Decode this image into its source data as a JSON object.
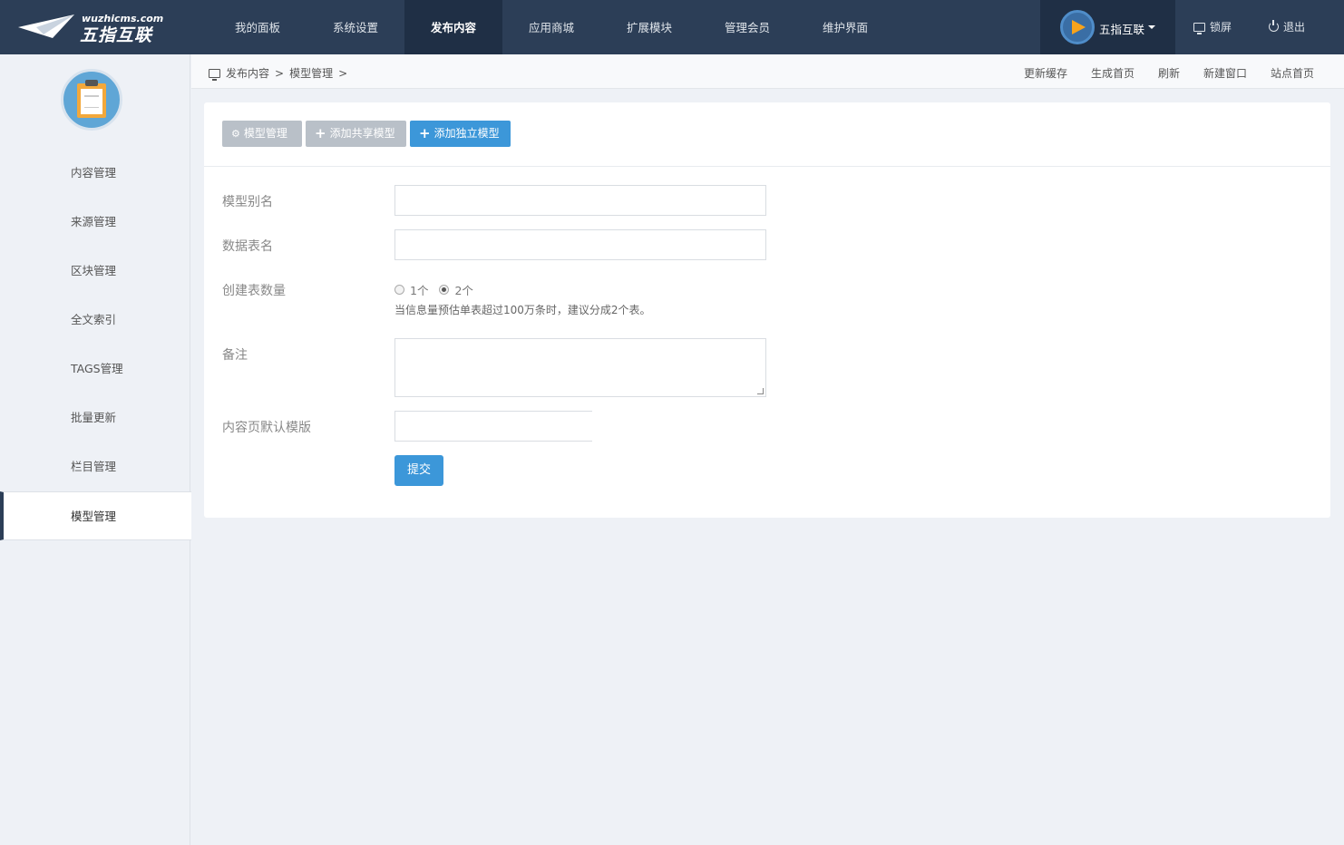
{
  "brand": {
    "url": "wuzhicms.com",
    "name": "五指互联"
  },
  "nav": {
    "items": [
      {
        "label": "我的面板"
      },
      {
        "label": "系统设置"
      },
      {
        "label": "发布内容"
      },
      {
        "label": "应用商城"
      },
      {
        "label": "扩展模块"
      },
      {
        "label": "管理会员"
      },
      {
        "label": "维护界面"
      }
    ],
    "active_index": 2
  },
  "user": {
    "name": "五指互联"
  },
  "top_actions": {
    "lock": "锁屏",
    "logout": "退出"
  },
  "sidebar": {
    "items": [
      {
        "label": "内容管理"
      },
      {
        "label": "来源管理"
      },
      {
        "label": "区块管理"
      },
      {
        "label": "全文索引"
      },
      {
        "label": "TAGS管理"
      },
      {
        "label": "批量更新"
      },
      {
        "label": "栏目管理"
      },
      {
        "label": "模型管理"
      }
    ],
    "active_index": 7
  },
  "breadcrumb": {
    "level1": "发布内容",
    "sep1": ">",
    "level2": "模型管理",
    "sep2": ">"
  },
  "quick_links": {
    "update_cache": "更新缓存",
    "gen_home": "生成首页",
    "refresh": "刷新",
    "new_window": "新建窗口",
    "site_home": "站点首页"
  },
  "toolbar": {
    "manage": "模型管理",
    "add_shared": "添加共享模型",
    "add_independent": "添加独立模型"
  },
  "form": {
    "alias_label": "模型别名",
    "alias_value": "",
    "table_label": "数据表名",
    "table_value": "",
    "count_label": "创建表数量",
    "count_options": [
      "1个",
      "2个"
    ],
    "count_selected": "2个",
    "count_hint": "当信息量预估单表超过100万条时，建议分成2个表。",
    "remark_label": "备注",
    "remark_value": "",
    "template_label": "内容页默认模版",
    "template_value": "",
    "submit": "提交"
  },
  "colors": {
    "topbar": "#2c3e57",
    "accent": "#3c97d9",
    "gray_button": "#b9c0c8"
  }
}
